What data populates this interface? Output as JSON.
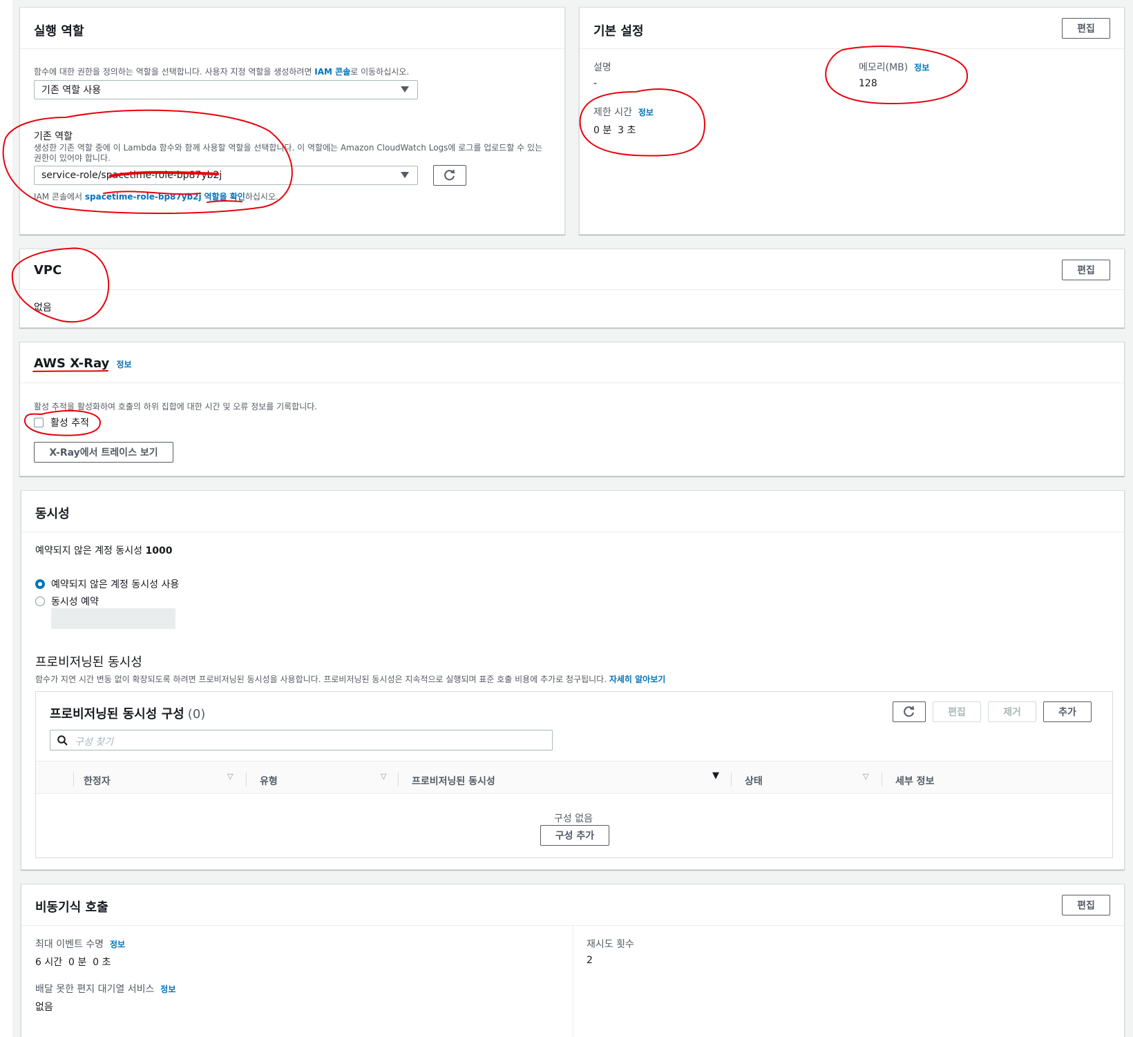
{
  "execution_role": {
    "title": "실행 역할",
    "description_prefix": "함수에 대한 권한을 정의하는 역할을 선택합니다. 사용자 지정 역할을 생성하려면 ",
    "iam_console_link": "IAM 콘솔",
    "description_suffix": "로 이동하십시오.",
    "role_mode_select": "기존 역할 사용",
    "existing_role_label": "기존 역할",
    "existing_role_help": "생성한 기존 역할 중에 이 Lambda 함수와 함께 사용할 역할을 선택합니다. 이 역할에는 Amazon CloudWatch Logs에 로그를 업로드할 수 있는 권한이 있어야 합니다.",
    "role_value": "service-role/spacetime-role-bp87yb2j",
    "view_prefix": "IAM 콘솔에서 ",
    "view_role_name": "spacetime-role-bp87yb2j",
    "view_role_link": "역할을 확인",
    "view_suffix": "하십시오."
  },
  "basic_settings": {
    "title": "기본 설정",
    "edit_label": "편집",
    "description_label": "설명",
    "description_value": "-",
    "memory_label": "메모리(MB)",
    "memory_info": "정보",
    "memory_value": "128",
    "timeout_label": "제한 시간",
    "timeout_info": "정보",
    "timeout_value": "0 분  3 초"
  },
  "vpc": {
    "title": "VPC",
    "edit_label": "편집",
    "value": "없음"
  },
  "xray": {
    "title": "AWS X-Ray",
    "info": "정보",
    "description": "활성 추적을 활성화하여 호출의 하위 집합에 대한 시간 및 오류 정보를 기록합니다.",
    "active_tracing_label": "활성 추적",
    "view_traces_button": "X-Ray에서 트레이스 보기"
  },
  "concurrency": {
    "title": "동시성",
    "unreserved_prefix": "예약되지 않은 계정 동시성 ",
    "unreserved_value": "1000",
    "option_unreserved": "예약되지 않은 계정 동시성 사용",
    "option_reserve": "동시성 예약",
    "provisioned_title": "프로비저닝된 동시성",
    "provisioned_desc": "함수가 지연 시간 변동 없이 확장되도록 하려면 프로비저닝된 동시성을 사용합니다. 프로비저닝된 동시성은 지속적으로 실행되며 표준 호출 비용에 추가로 청구됩니다. ",
    "learn_more": "자세히 알아보기",
    "config_title": "프로비저닝된 동시성 구성",
    "config_count": "(0)",
    "edit_label": "편집",
    "remove_label": "제거",
    "add_label": "추가",
    "search_placeholder": "구성 찾기",
    "columns": [
      "한정자",
      "유형",
      "프로비저닝된 동시성",
      "상태",
      "세부 정보"
    ],
    "empty_text": "구성 없음",
    "add_config_button": "구성 추가"
  },
  "async": {
    "title": "비동기식 호출",
    "edit_label": "편집",
    "max_event_age_label": "최대 이벤트 수명",
    "max_event_age_info": "정보",
    "max_event_age_value": "6 시간  0 분  0 초",
    "retry_label": "재시도 횟수",
    "retry_value": "2",
    "dlq_label": "배달 못한 편지 대기열 서비스",
    "dlq_info": "정보",
    "dlq_value": "없음"
  },
  "colors": {
    "accent": "#0073bb",
    "annotation": "#e8000b",
    "border": "#d5dbdb"
  }
}
